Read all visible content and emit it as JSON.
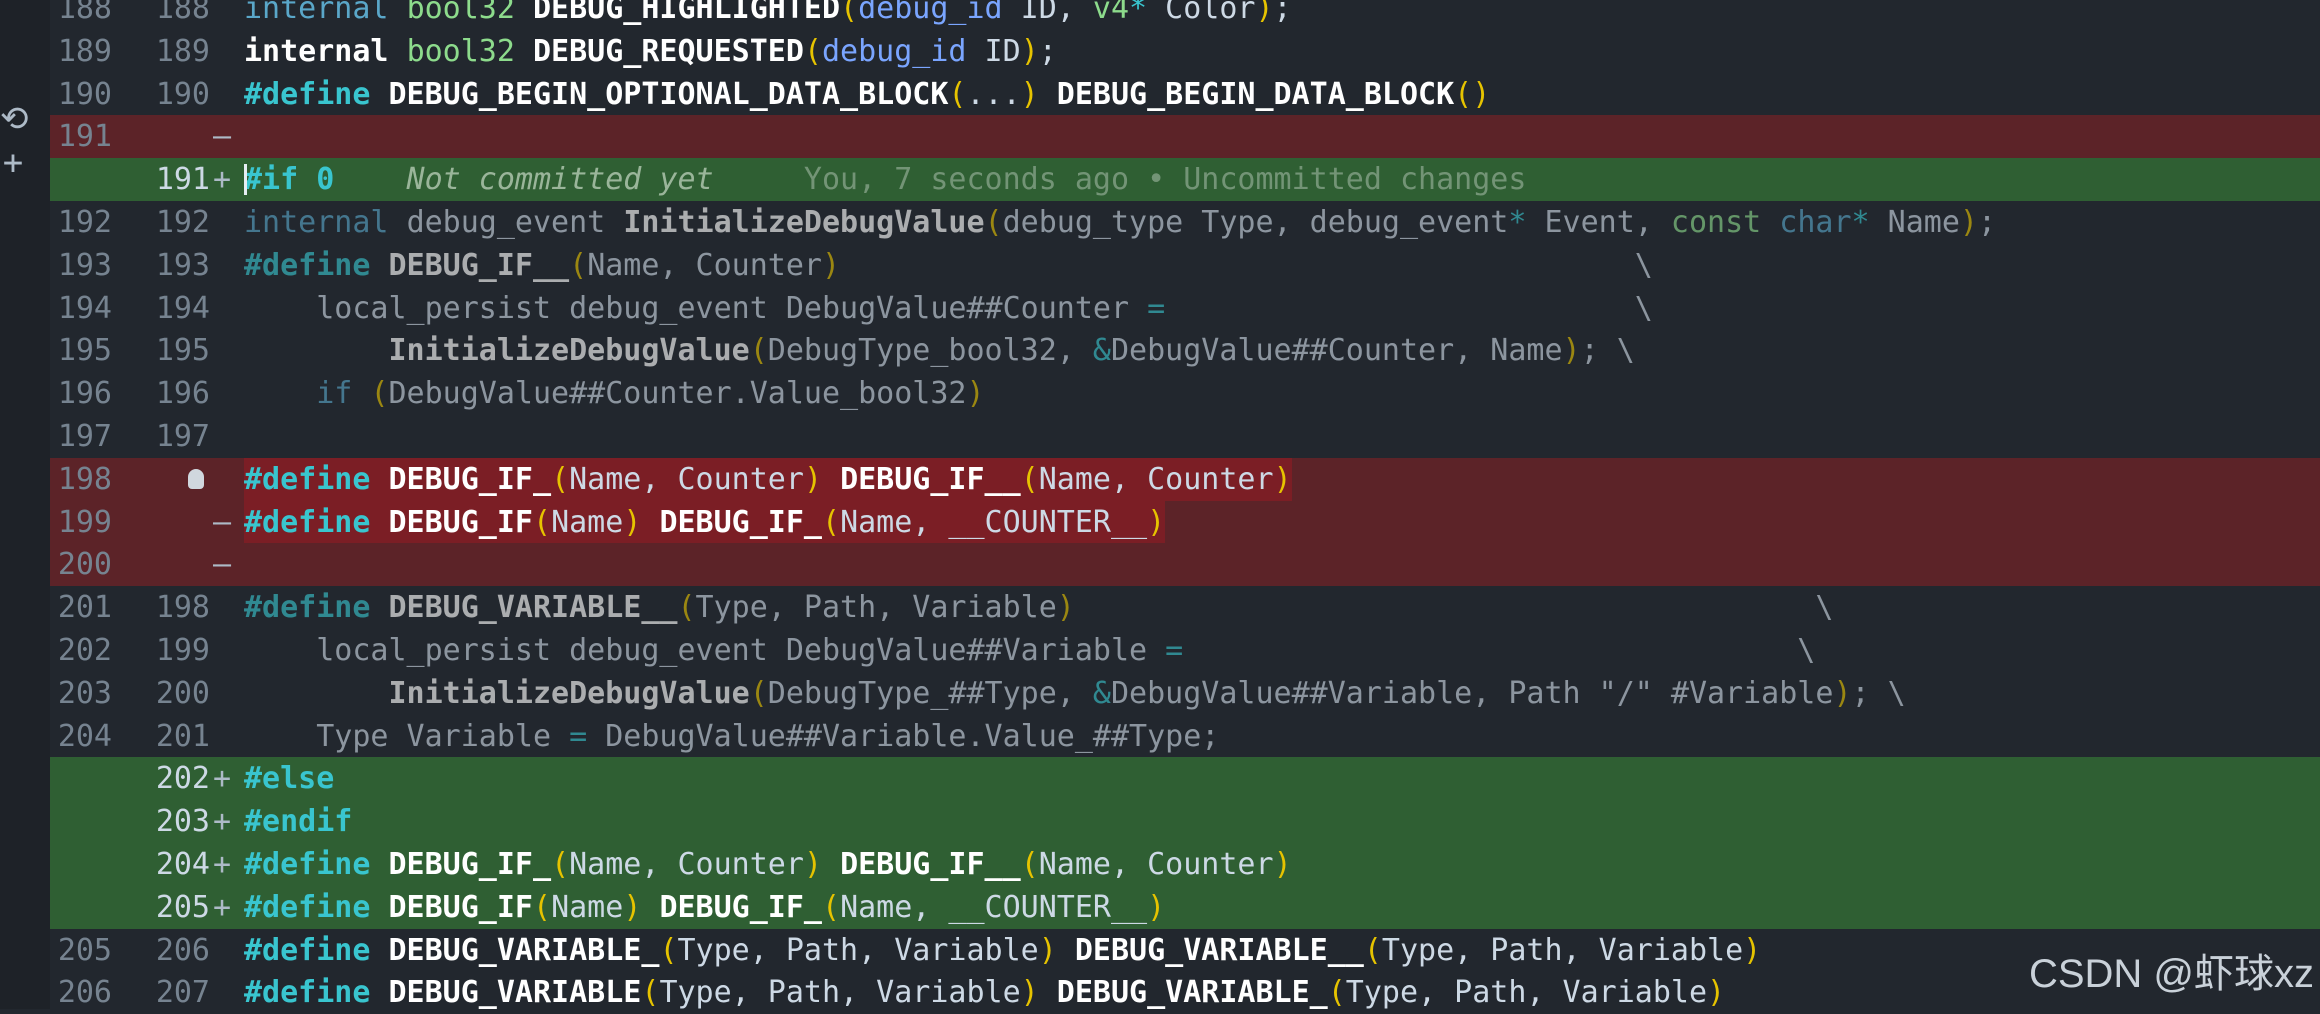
{
  "editor": {
    "lines": [
      {
        "old": "188",
        "new": "188",
        "mark": "",
        "type": "ctx",
        "code": [
          [
            "kw2",
            "internal "
          ],
          [
            "ty",
            "bool32 "
          ],
          [
            "fn",
            "DEBUG_HIGHLIGHTED"
          ],
          [
            "pn",
            "("
          ],
          [
            "bl",
            "debug_id"
          ],
          [
            "pl",
            " ID, "
          ],
          [
            "ty",
            "v4"
          ],
          [
            "op",
            "*"
          ],
          [
            "pl",
            " Color"
          ],
          [
            "pn",
            ")"
          ],
          [
            "pl",
            ";"
          ]
        ]
      },
      {
        "old": "189",
        "new": "189",
        "mark": "",
        "type": "ctx",
        "code": [
          [
            "fn",
            "internal "
          ],
          [
            "ty",
            "bool32 "
          ],
          [
            "fn",
            "DEBUG_REQUESTED"
          ],
          [
            "pn",
            "("
          ],
          [
            "bl",
            "debug_id"
          ],
          [
            "pl",
            " ID"
          ],
          [
            "pn",
            ")"
          ],
          [
            "pl",
            ";"
          ]
        ]
      },
      {
        "old": "190",
        "new": "190",
        "mark": "",
        "type": "ctx",
        "code": [
          [
            "kw",
            "#define "
          ],
          [
            "fn",
            "DEBUG_BEGIN_OPTIONAL_DATA_BLOCK"
          ],
          [
            "pn",
            "("
          ],
          [
            "pl",
            "..."
          ],
          [
            "pn",
            ")"
          ],
          [
            "pl",
            " "
          ],
          [
            "fn",
            "DEBUG_BEGIN_DATA_BLOCK"
          ],
          [
            "pn",
            "()"
          ]
        ]
      },
      {
        "old": "191",
        "new": "",
        "mark": "—",
        "type": "del",
        "code": []
      },
      {
        "old": "",
        "new": "191",
        "mark": "+",
        "type": "add",
        "code": [
          [
            "kw",
            "#if 0"
          ],
          [
            "cm",
            "    Not committed yet"
          ],
          [
            "blame",
            "     You, 7 seconds ago • Uncommitted changes"
          ]
        ]
      },
      {
        "old": "192",
        "new": "192",
        "mark": "",
        "type": "dim",
        "code": [
          [
            "kw2",
            "internal "
          ],
          [
            "pl",
            "debug_event "
          ],
          [
            "fn",
            "InitializeDebugValue"
          ],
          [
            "pn",
            "("
          ],
          [
            "pl",
            "debug_type Type, debug_event"
          ],
          [
            "op",
            "*"
          ],
          [
            "pl",
            " Event, "
          ],
          [
            "ty",
            "const "
          ],
          [
            "kw2",
            "char"
          ],
          [
            "op",
            "*"
          ],
          [
            "pl",
            " Name"
          ],
          [
            "pn",
            ")"
          ],
          [
            "pl",
            ";"
          ]
        ]
      },
      {
        "old": "193",
        "new": "193",
        "mark": "",
        "type": "dim",
        "code": [
          [
            "kw",
            "#define "
          ],
          [
            "fn",
            "DEBUG_IF__"
          ],
          [
            "pn",
            "("
          ],
          [
            "pl",
            "Name, Counter"
          ],
          [
            "pn",
            ")"
          ],
          [
            "pl",
            "                                            \\"
          ]
        ]
      },
      {
        "old": "194",
        "new": "194",
        "mark": "",
        "type": "dim",
        "code": [
          [
            "pl",
            "    local_persist debug_event DebugValue##Counter "
          ],
          [
            "op",
            "="
          ],
          [
            "pl",
            "                          \\"
          ]
        ]
      },
      {
        "old": "195",
        "new": "195",
        "mark": "",
        "type": "dim",
        "code": [
          [
            "pl",
            "        "
          ],
          [
            "fn",
            "InitializeDebugValue"
          ],
          [
            "pn",
            "("
          ],
          [
            "pl",
            "DebugType_bool32, "
          ],
          [
            "op",
            "&"
          ],
          [
            "pl",
            "DebugValue##Counter, Name"
          ],
          [
            "pn",
            ")"
          ],
          [
            "pl",
            "; \\"
          ]
        ]
      },
      {
        "old": "196",
        "new": "196",
        "mark": "",
        "type": "dim",
        "code": [
          [
            "kw2",
            "    if "
          ],
          [
            "pn",
            "("
          ],
          [
            "pl",
            "DebugValue##Counter.Value_bool32"
          ],
          [
            "pn",
            ")"
          ]
        ]
      },
      {
        "old": "197",
        "new": "197",
        "mark": "",
        "type": "dim",
        "code": []
      },
      {
        "old": "198",
        "new": "",
        "mark": "bulb",
        "type": "del",
        "code": [
          [
            "kw",
            "#define "
          ],
          [
            "fn",
            "DEBUG_IF_"
          ],
          [
            "pn",
            "("
          ],
          [
            "pl",
            "Name, Counter"
          ],
          [
            "pn",
            ")"
          ],
          [
            "pl",
            " "
          ],
          [
            "fn",
            "DEBUG_IF__"
          ],
          [
            "pn",
            "("
          ],
          [
            "pl",
            "Name, Counter"
          ],
          [
            "pn",
            ")"
          ]
        ]
      },
      {
        "old": "199",
        "new": "",
        "mark": "—",
        "type": "del",
        "code": [
          [
            "kw",
            "#define "
          ],
          [
            "fn",
            "DEBUG_IF"
          ],
          [
            "pn",
            "("
          ],
          [
            "pl",
            "Name"
          ],
          [
            "pn",
            ")"
          ],
          [
            "pl",
            " "
          ],
          [
            "fn",
            "DEBUG_IF_"
          ],
          [
            "pn",
            "("
          ],
          [
            "pl",
            "Name, __COUNTER__"
          ],
          [
            "pn",
            ")"
          ]
        ]
      },
      {
        "old": "200",
        "new": "",
        "mark": "—",
        "type": "del",
        "code": []
      },
      {
        "old": "201",
        "new": "198",
        "mark": "",
        "type": "dim",
        "code": [
          [
            "kw",
            "#define "
          ],
          [
            "fn",
            "DEBUG_VARIABLE__"
          ],
          [
            "pn",
            "("
          ],
          [
            "pl",
            "Type, Path, Variable"
          ],
          [
            "pn",
            ")"
          ],
          [
            "pl",
            "                                         \\"
          ]
        ]
      },
      {
        "old": "202",
        "new": "199",
        "mark": "",
        "type": "dim",
        "code": [
          [
            "pl",
            "    local_persist debug_event DebugValue##Variable "
          ],
          [
            "op",
            "="
          ],
          [
            "pl",
            "                                  \\"
          ]
        ]
      },
      {
        "old": "203",
        "new": "200",
        "mark": "",
        "type": "dim",
        "code": [
          [
            "pl",
            "        "
          ],
          [
            "fn",
            "InitializeDebugValue"
          ],
          [
            "pn",
            "("
          ],
          [
            "pl",
            "DebugType_##Type, "
          ],
          [
            "op",
            "&"
          ],
          [
            "pl",
            "DebugValue##Variable, Path \"/\" #Variable"
          ],
          [
            "pn",
            ")"
          ],
          [
            "pl",
            "; \\"
          ]
        ]
      },
      {
        "old": "204",
        "new": "201",
        "mark": "",
        "type": "dim",
        "code": [
          [
            "pl",
            "    Type Variable "
          ],
          [
            "op",
            "="
          ],
          [
            "pl",
            " DebugValue##Variable.Value_##Type;"
          ]
        ]
      },
      {
        "old": "",
        "new": "202",
        "mark": "+",
        "type": "add",
        "code": [
          [
            "kw",
            "#else"
          ]
        ]
      },
      {
        "old": "",
        "new": "203",
        "mark": "+",
        "type": "add",
        "code": [
          [
            "kw",
            "#endif"
          ]
        ]
      },
      {
        "old": "",
        "new": "204",
        "mark": "+",
        "type": "add",
        "code": [
          [
            "kw",
            "#define "
          ],
          [
            "fn",
            "DEBUG_IF_"
          ],
          [
            "pn",
            "("
          ],
          [
            "pl",
            "Name, Counter"
          ],
          [
            "pn",
            ")"
          ],
          [
            "pl",
            " "
          ],
          [
            "fn",
            "DEBUG_IF__"
          ],
          [
            "pn",
            "("
          ],
          [
            "pl",
            "Name, Counter"
          ],
          [
            "pn",
            ")"
          ]
        ]
      },
      {
        "old": "",
        "new": "205",
        "mark": "+",
        "type": "add",
        "code": [
          [
            "kw",
            "#define "
          ],
          [
            "fn",
            "DEBUG_IF"
          ],
          [
            "pn",
            "("
          ],
          [
            "pl",
            "Name"
          ],
          [
            "pn",
            ")"
          ],
          [
            "pl",
            " "
          ],
          [
            "fn",
            "DEBUG_IF_"
          ],
          [
            "pn",
            "("
          ],
          [
            "pl",
            "Name, __COUNTER__"
          ],
          [
            "pn",
            ")"
          ]
        ]
      },
      {
        "old": "205",
        "new": "206",
        "mark": "",
        "type": "ctx",
        "code": [
          [
            "kw",
            "#define "
          ],
          [
            "fn",
            "DEBUG_VARIABLE_"
          ],
          [
            "pn",
            "("
          ],
          [
            "pl",
            "Type, Path, Variable"
          ],
          [
            "pn",
            ")"
          ],
          [
            "pl",
            " "
          ],
          [
            "fn",
            "DEBUG_VARIABLE__"
          ],
          [
            "pn",
            "("
          ],
          [
            "pl",
            "Type, Path, Variable"
          ],
          [
            "pn",
            ")"
          ]
        ]
      },
      {
        "old": "206",
        "new": "207",
        "mark": "",
        "type": "ctx",
        "code": [
          [
            "kw",
            "#define "
          ],
          [
            "fn",
            "DEBUG_VARIABLE"
          ],
          [
            "pn",
            "("
          ],
          [
            "pl",
            "Type, Path, Variable"
          ],
          [
            "pn",
            ")"
          ],
          [
            "pl",
            " "
          ],
          [
            "fn",
            "DEBUG_VARIABLE_"
          ],
          [
            "pn",
            "("
          ],
          [
            "pl",
            "Type, Path, Variable"
          ],
          [
            "pn",
            ")"
          ]
        ]
      }
    ]
  },
  "gutter": {
    "undo_icon": "undo-icon",
    "add_icon": "plus-icon"
  },
  "watermark": {
    "text": "CSDN @虾球xz"
  }
}
